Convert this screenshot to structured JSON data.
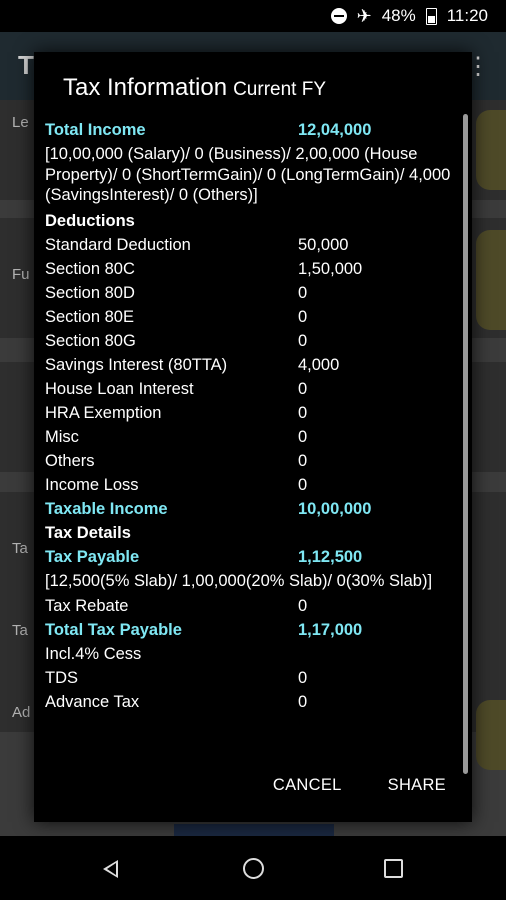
{
  "status_bar": {
    "battery": "48%",
    "time": "11:20"
  },
  "background": {
    "app_title_initial": "T",
    "labels": [
      "Le",
      "Fu",
      "Ta",
      "Ta",
      "Ad"
    ]
  },
  "dialog": {
    "title": "Tax Information",
    "subtitle": "Current FY",
    "total_income": {
      "label": "Total Income",
      "value": "12,04,000"
    },
    "income_breakdown": "[10,00,000 (Salary)/ 0 (Business)/ 2,00,000 (House Property)/ 0 (ShortTermGain)/ 0 (LongTermGain)/ 4,000 (SavingsInterest)/ 0 (Others)]",
    "deductions_heading": "Deductions",
    "deductions": [
      {
        "label": "Standard Deduction",
        "value": "50,000"
      },
      {
        "label": "Section 80C",
        "value": "1,50,000"
      },
      {
        "label": "Section 80D",
        "value": "0"
      },
      {
        "label": "Section 80E",
        "value": "0"
      },
      {
        "label": "Section 80G",
        "value": "0"
      },
      {
        "label": "Savings Interest (80TTA)",
        "value": "4,000"
      },
      {
        "label": "House Loan Interest",
        "value": "0"
      },
      {
        "label": "HRA Exemption",
        "value": "0"
      },
      {
        "label": "Misc",
        "value": "0"
      },
      {
        "label": "Others",
        "value": "0"
      },
      {
        "label": "Income Loss",
        "value": "0"
      }
    ],
    "taxable_income": {
      "label": "Taxable Income",
      "value": "10,00,000"
    },
    "tax_details_heading": "Tax Details",
    "tax_payable": {
      "label": "Tax Payable",
      "value": "1,12,500"
    },
    "slab_breakdown": "[12,500(5% Slab)/ 1,00,000(20% Slab)/ 0(30% Slab)]",
    "tax_rebate": {
      "label": "Tax Rebate",
      "value": "0"
    },
    "total_tax_payable": {
      "label": "Total Tax Payable",
      "value": "1,17,000"
    },
    "cess_note": "Incl.4% Cess",
    "tds": {
      "label": "TDS",
      "value": "0"
    },
    "advance_tax": {
      "label": "Advance Tax",
      "value": "0"
    },
    "cancel_label": "CANCEL",
    "share_label": "SHARE"
  },
  "colors": {
    "accent": "#7fe7f3",
    "dialog_bg": "#000000"
  }
}
